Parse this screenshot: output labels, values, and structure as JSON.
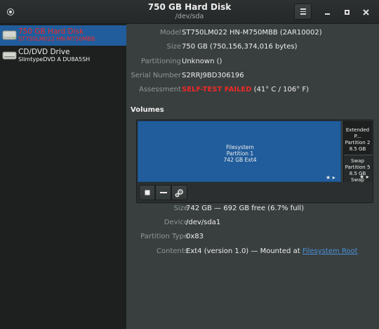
{
  "window": {
    "title": "750 GB Hard Disk",
    "subtitle": "/dev/sda"
  },
  "sidebar": {
    "drives": [
      {
        "name": "750 GB Hard Disk",
        "model": "ST750LM022 HN-M750MBB",
        "selected": true,
        "warning": true
      },
      {
        "name": "CD/DVD Drive",
        "model": "SlimtypeDVD A DU8A5SH",
        "selected": false
      }
    ]
  },
  "drive_info": {
    "model": {
      "label": "Model",
      "value": "ST750LM022 HN-M750MBB (2AR10002)"
    },
    "size": {
      "label": "Size",
      "value": "750 GB (750,156,374,016 bytes)"
    },
    "partitioning": {
      "label": "Partitioning",
      "value": "Unknown ()"
    },
    "serial": {
      "label": "Serial Number",
      "value": "S2RRJ9BD306196"
    },
    "assessment": {
      "label": "Assessment",
      "status": "SELF-TEST FAILED",
      "temperature": "(41° C / 106° F)"
    }
  },
  "volumes": {
    "heading": "Volumes",
    "partitions": [
      {
        "line1": "Filesystem",
        "line2": "Partition 1",
        "line3": "742 GB Ext4",
        "selected": true
      },
      {
        "line1": "Extended P...",
        "line2": "Partition 2",
        "line3": "8.5 GB"
      },
      {
        "line1": "Swap",
        "line2": "Partition 5",
        "line3": "8.5 GB Swap"
      }
    ],
    "marks": "★ ▸",
    "toolbar": {
      "stop_icon": "stop-icon",
      "remove_icon": "minus-icon",
      "settings_icon": "gears-icon"
    }
  },
  "partition_info": {
    "size": {
      "label": "Size",
      "value": "742 GB — 692 GB free (6.7% full)"
    },
    "device": {
      "label": "Device",
      "value": "/dev/sda1"
    },
    "type": {
      "label": "Partition Type",
      "value": "0x83"
    },
    "contents": {
      "label": "Contents",
      "value": "Ext4 (version 1.0) — Mounted at ",
      "link": "Filesystem Root"
    }
  },
  "colors": {
    "accent": "#215d9c",
    "error": "#ef2929",
    "link": "#4a90d9",
    "background": "#393f3f",
    "sidebar": "#1e2020"
  }
}
